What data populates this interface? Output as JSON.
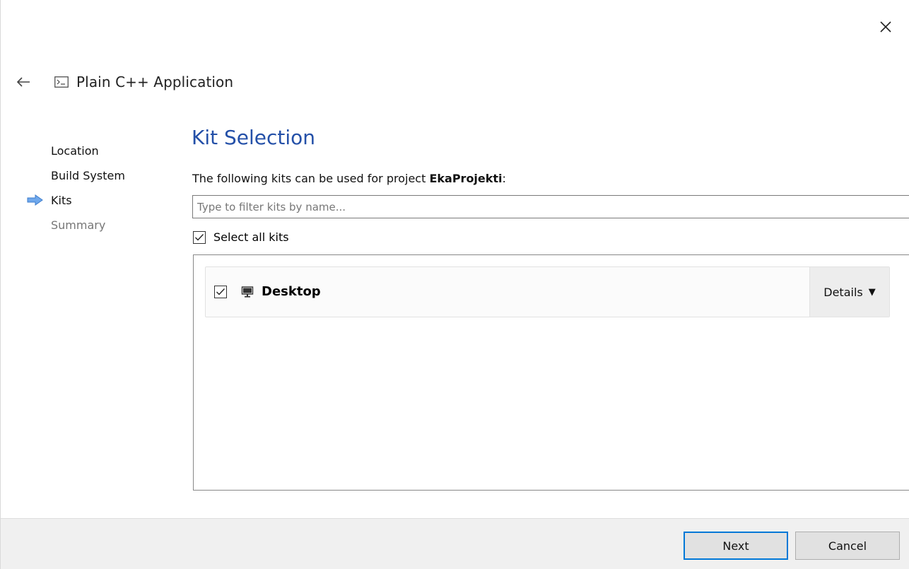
{
  "window": {
    "close_icon": "close-icon"
  },
  "header": {
    "back_icon": "back-arrow-icon",
    "app_icon": "terminal-icon",
    "title": "Plain C++ Application"
  },
  "steps": [
    {
      "label": "Location",
      "state": "done"
    },
    {
      "label": "Build System",
      "state": "done"
    },
    {
      "label": "Kits",
      "state": "current"
    },
    {
      "label": "Summary",
      "state": "future"
    }
  ],
  "main": {
    "title": "Kit Selection",
    "intro_prefix": "The following kits can be used for project ",
    "project_name": "EkaProjekti",
    "intro_suffix": ":",
    "filter_placeholder": "Type to filter kits by name...",
    "filter_value": "",
    "select_all_label": "Select all kits",
    "select_all_checked": true,
    "kits": [
      {
        "name": "Desktop",
        "checked": true,
        "icon": "monitor-icon",
        "details_label": "Details",
        "details_caret": "▼"
      }
    ]
  },
  "footer": {
    "next_label": "Next",
    "cancel_label": "Cancel"
  },
  "colors": {
    "title": "#2450a8",
    "step_arrow": "#4a90e2",
    "primary_border": "#0078d7",
    "footer_bg": "#f0f0f0"
  }
}
